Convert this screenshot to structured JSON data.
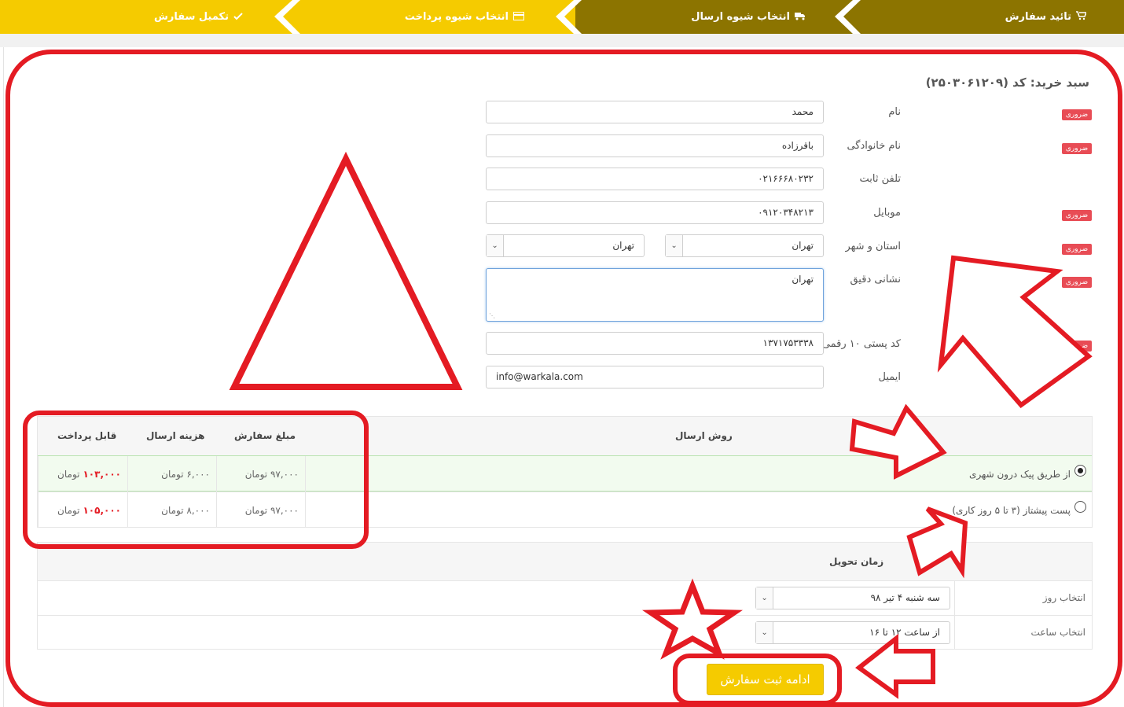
{
  "steps": [
    {
      "label": "تائید سفارش",
      "icon": "shopping-cart-icon"
    },
    {
      "label": "انتخاب شیوه ارسال",
      "icon": "truck-icon"
    },
    {
      "label": "انتخاب شیوه پرداخت",
      "icon": "credit-card-icon"
    },
    {
      "label": "تکمیل سفارش",
      "icon": "check-icon"
    }
  ],
  "colors": {
    "step_done": "#8c7400",
    "step_pending": "#f5cb00",
    "required": "#e84c55",
    "accent_red": "#e41b23",
    "submit": "#f5cb00"
  },
  "cart_title": "سبد خرید: کد (۲۵۰۳۰۶۱۲۰۹)",
  "required_label": "ضروری",
  "form": {
    "first_name": {
      "label": "نام",
      "value": "محمد"
    },
    "last_name": {
      "label": "نام خانوادگی",
      "value": "باقرزاده"
    },
    "phone": {
      "label": "تلفن ثابت",
      "value": "۰۲۱۶۶۶۸۰۲۳۲"
    },
    "mobile": {
      "label": "موبایل",
      "value": "۰۹۱۲۰۳۴۸۲۱۳"
    },
    "province_city": {
      "label": "استان و شهر",
      "province": "تهران",
      "city": "تهران"
    },
    "address": {
      "label": "نشانی دقیق",
      "value": "تهران"
    },
    "postal_code": {
      "label": "کد پستی ۱۰ رقمی",
      "value": "۱۳۷۱۷۵۳۳۳۸"
    },
    "email": {
      "label": "ایمیل",
      "value": "info@warkala.com"
    }
  },
  "shipping": {
    "headers": {
      "method": "روش ارسال",
      "order_amount": "مبلغ سفارش",
      "shipping_cost": "هزینه ارسال",
      "payable": "قابل پرداخت"
    },
    "rows": [
      {
        "name": "از طریق پیک درون شهری",
        "order_amount": "۹۷,۰۰۰ تومان",
        "shipping_cost": "۶,۰۰۰ تومان",
        "payable_value": "۱۰۳,۰۰۰",
        "payable_unit": "تومان",
        "selected": true
      },
      {
        "name": "پست پیشتاز (۳ تا ۵ روز کاری)",
        "order_amount": "۹۷,۰۰۰ تومان",
        "shipping_cost": "۸,۰۰۰ تومان",
        "payable_value": "۱۰۵,۰۰۰",
        "payable_unit": "تومان",
        "selected": false
      }
    ]
  },
  "delivery": {
    "header": "زمان تحویل",
    "day": {
      "label": "انتخاب روز",
      "value": "سه شنبه ۴ تیر ۹۸"
    },
    "hour": {
      "label": "انتخاب ساعت",
      "value": "از ساعت ۱۲ تا ۱۶"
    }
  },
  "submit_label": "ادامه ثبت سفارش"
}
